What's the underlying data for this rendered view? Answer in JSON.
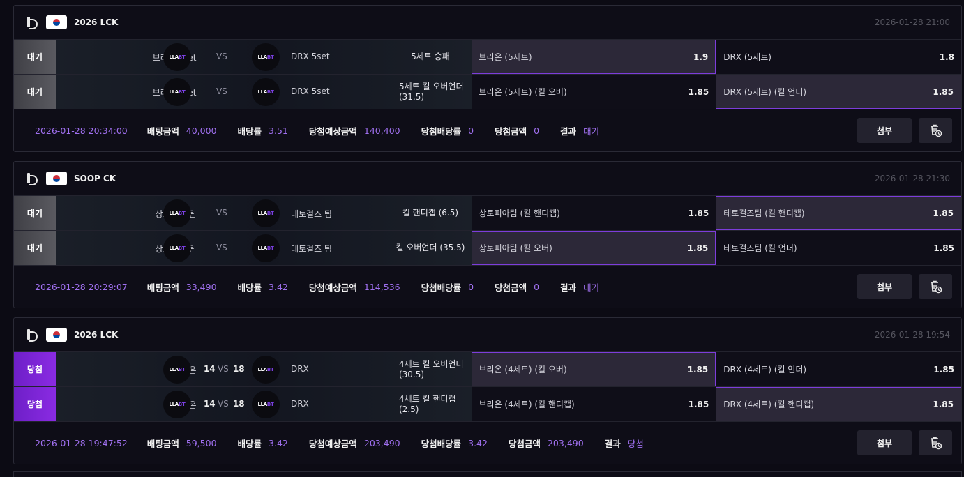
{
  "icons": {
    "league": "lol-icon",
    "flag": "south-korea-flag-icon",
    "delete": "trash-clock-icon"
  },
  "colors": {
    "accent": "#a070f0",
    "selected_border": "#7d3ddb",
    "win": "#8a2be2",
    "wait": "#505056"
  },
  "team_logo_text": "LLA",
  "team_logo_sub": "BT",
  "attach_label": "첨부",
  "cards": [
    {
      "league": "2026 LCK",
      "time": "2026-01-28 21:00",
      "rows": [
        {
          "status": "대기",
          "home": "브리온 5set",
          "vs": "VS",
          "away": "DRX 5set",
          "market": "5세트 승패",
          "odd1": "브리온 (5세트)",
          "val1": "1.9",
          "odd2": "DRX (5세트)",
          "val2": "1.8",
          "sel": 1
        },
        {
          "status": "대기",
          "home": "브리온 5set",
          "vs": "VS",
          "away": "DRX 5set",
          "market": "5세트 킬 오버언더 (31.5)",
          "odd1": "브리온 (5세트) (킬 오버)",
          "val1": "1.85",
          "odd2": "DRX (5세트) (킬 언더)",
          "val2": "1.85",
          "sel": 2
        }
      ],
      "summary": {
        "datetime": "2026-01-28 20:34:00",
        "bet_label": "배팅금액",
        "bet": "40,000",
        "rate_label": "배당률",
        "rate": "3.51",
        "expected_label": "당첨예상금액",
        "expected": "140,400",
        "win_rate_label": "당첨배당률",
        "win_rate": "0",
        "win_amount_label": "당첨금액",
        "win_amount": "0",
        "result_label": "결과",
        "result": "대기"
      }
    },
    {
      "league": "SOOP CK",
      "time": "2026-01-28 21:30",
      "rows": [
        {
          "status": "대기",
          "home": "상토피아 팀",
          "vs": "VS",
          "away": "테토걸즈 팀",
          "market": "킬 핸디캡 (6.5)",
          "odd1": "상토피아팀 (킬 핸디캡)",
          "val1": "1.85",
          "odd2": "테토걸즈팀 (킬 핸디캡)",
          "val2": "1.85",
          "sel": 2
        },
        {
          "status": "대기",
          "home": "상토피아 팀",
          "vs": "VS",
          "away": "테토걸즈 팀",
          "market": "킬 오버언더 (35.5)",
          "odd1": "상토피아팀 (킬 오버)",
          "val1": "1.85",
          "odd2": "테토걸즈팀 (킬 언더)",
          "val2": "1.85",
          "sel": 1
        }
      ],
      "summary": {
        "datetime": "2026-01-28 20:29:07",
        "bet_label": "배팅금액",
        "bet": "33,490",
        "rate_label": "배당률",
        "rate": "3.42",
        "expected_label": "당첨예상금액",
        "expected": "114,536",
        "win_rate_label": "당첨배당률",
        "win_rate": "0",
        "win_amount_label": "당첨금액",
        "win_amount": "0",
        "result_label": "결과",
        "result": "대기"
      }
    },
    {
      "league": "2026 LCK",
      "time": "2026-01-28 19:54",
      "rows": [
        {
          "status": "당첨",
          "home": "브리온",
          "score_home": "14",
          "vs": "VS",
          "score_away": "18",
          "away": "DRX",
          "market": "4세트 킬 오버언더 (30.5)",
          "odd1": "브리온 (4세트) (킬 오버)",
          "val1": "1.85",
          "odd2": "DRX (4세트) (킬 언더)",
          "val2": "1.85",
          "sel": 1
        },
        {
          "status": "당첨",
          "home": "브리온",
          "score_home": "14",
          "vs": "VS",
          "score_away": "18",
          "away": "DRX",
          "market": "4세트 킬 핸디캡 (2.5)",
          "odd1": "브리온 (4세트) (킬 핸디캡)",
          "val1": "1.85",
          "odd2": "DRX (4세트) (킬 핸디캡)",
          "val2": "1.85",
          "sel": 2
        }
      ],
      "summary": {
        "datetime": "2026-01-28 19:47:52",
        "bet_label": "배팅금액",
        "bet": "59,500",
        "rate_label": "배당률",
        "rate": "3.42",
        "expected_label": "당첨예상금액",
        "expected": "203,490",
        "win_rate_label": "당첨배당률",
        "win_rate": "3.42",
        "win_amount_label": "당첨금액",
        "win_amount": "203,490",
        "result_label": "결과",
        "result": "당첨"
      }
    }
  ]
}
